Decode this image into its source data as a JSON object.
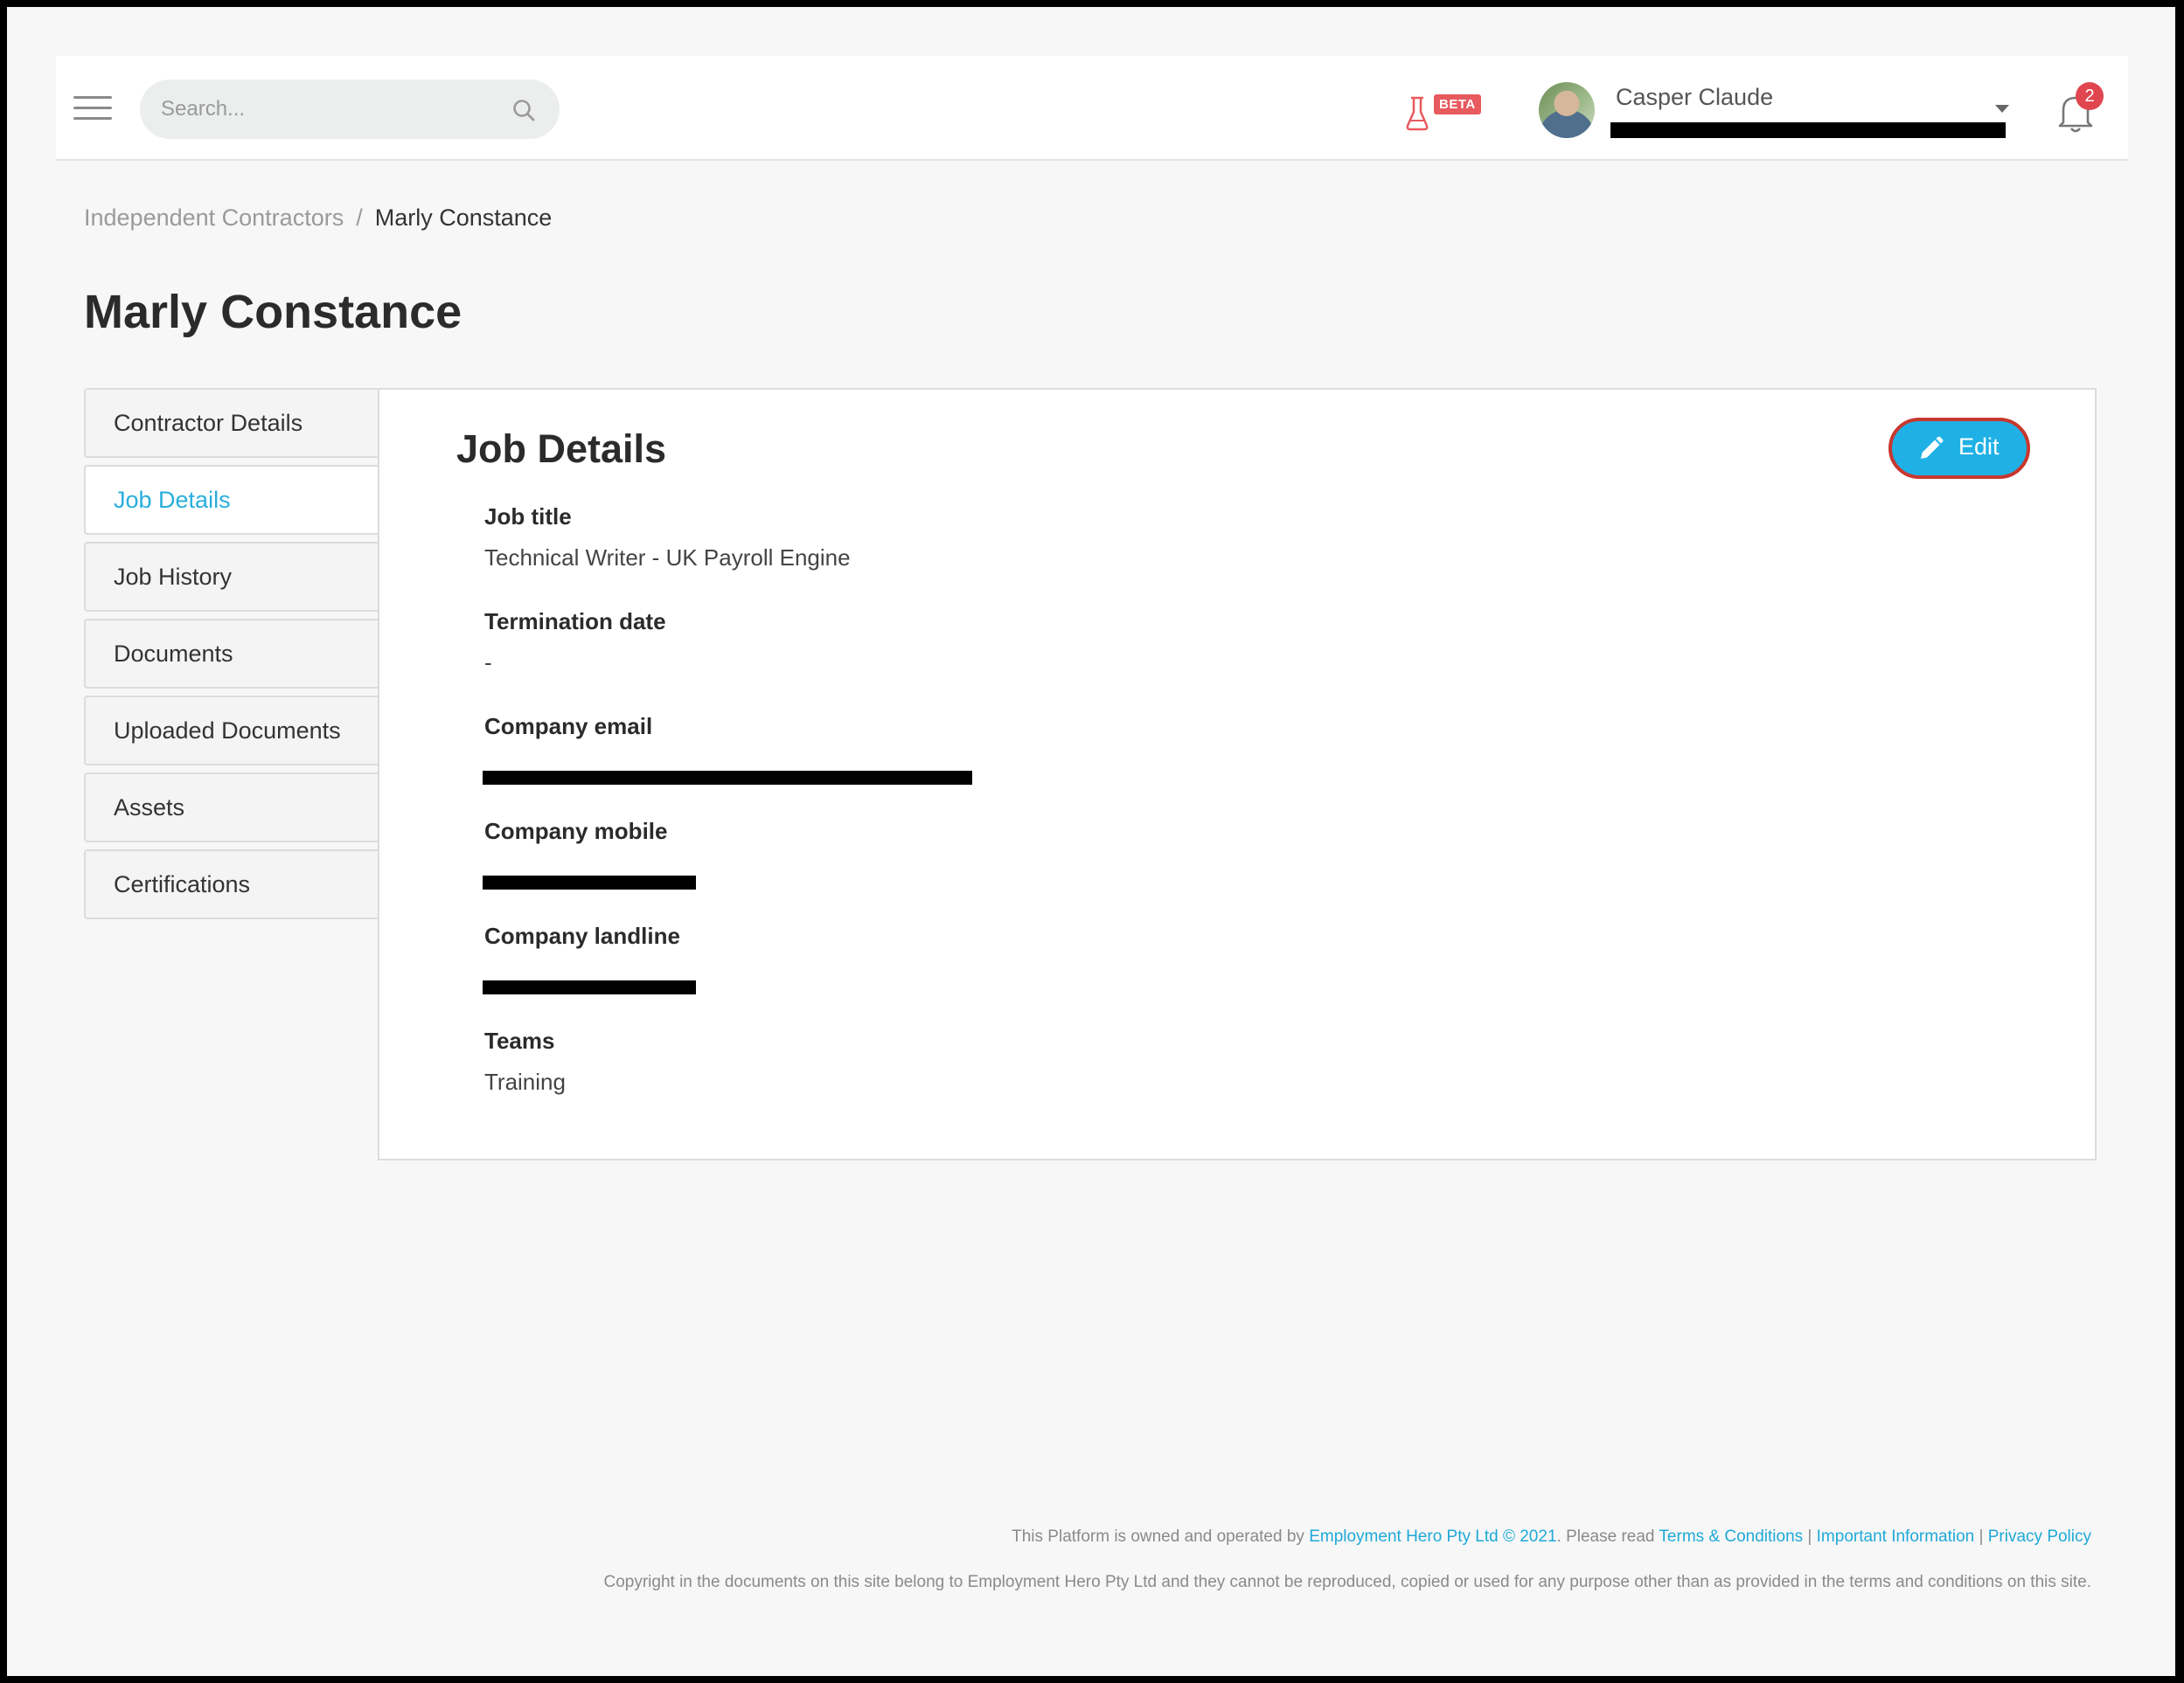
{
  "header": {
    "search_placeholder": "Search...",
    "beta_label": "BETA",
    "user_name": "Casper Claude",
    "notification_count": "2"
  },
  "breadcrumb": {
    "parent": "Independent Contractors",
    "separator": "/",
    "current": "Marly Constance"
  },
  "page_title": "Marly Constance",
  "sidebar": {
    "items": [
      {
        "label": "Contractor Details"
      },
      {
        "label": "Job Details"
      },
      {
        "label": "Job History"
      },
      {
        "label": "Documents"
      },
      {
        "label": "Uploaded Documents"
      },
      {
        "label": "Assets"
      },
      {
        "label": "Certifications"
      }
    ],
    "active": "Job Details"
  },
  "panel": {
    "title": "Job Details",
    "edit_label": "Edit",
    "fields": [
      {
        "label": "Job title",
        "value": "Technical Writer - UK Payroll Engine"
      },
      {
        "label": "Termination date",
        "value": "-"
      },
      {
        "label": "Company email",
        "value": ""
      },
      {
        "label": "Company mobile",
        "value": ""
      },
      {
        "label": "Company landline",
        "value": ""
      },
      {
        "label": "Teams",
        "value": "Training"
      }
    ]
  },
  "footer": {
    "line1_prefix": "This Platform is owned and operated by ",
    "company_link": "Employment Hero Pty Ltd © 2021",
    "line1_middle": ". Please read ",
    "terms_link": "Terms & Conditions",
    "divider": " | ",
    "info_link": "Important Information",
    "privacy_link": "Privacy Policy",
    "line2": "Copyright in the documents on this site belong to Employment Hero Pty Ltd and they cannot be reproduced, copied or used for any purpose other than as provided in the terms and conditions on this site."
  },
  "colors": {
    "accent": "#29aedb",
    "edit_button": "#1fb1e6",
    "notification_badge": "#e0464f",
    "beta_badge": "#e85a5e"
  },
  "icons": [
    "hamburger-icon",
    "search-icon",
    "flask-icon",
    "chevron-down-icon",
    "bell-icon",
    "pencil-icon"
  ]
}
